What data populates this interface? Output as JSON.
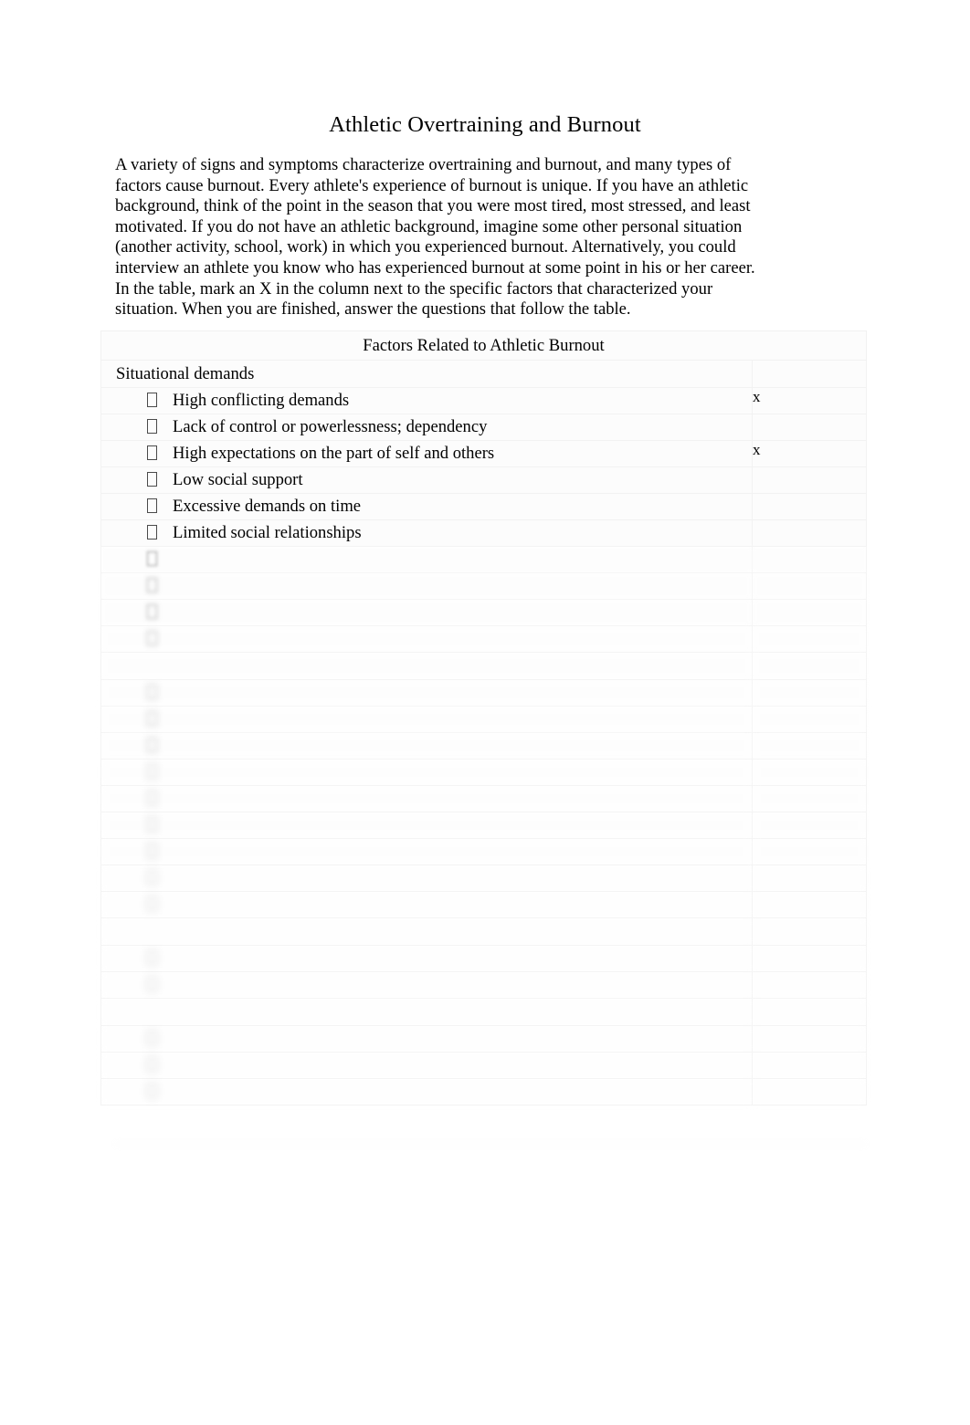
{
  "document": {
    "title": "Athletic Overtraining and Burnout",
    "intro_paragraphs": [
      "A variety of signs and symptoms characterize overtraining and burnout, and many types of factors cause burnout. Every athlete's experience of burnout is unique. If you have an athletic background, think of the point in the season that you were most tired, most stressed, and least motivated. If you do not have an athletic background, imagine some other personal situation (another activity, school, work) in which you experienced burnout. Alternatively, you could interview an athlete you know who has experienced burnout at some point in his or her career.",
      "In the table, mark an X in the column next to the specific factors that characterized your situation. When you are finished, answer the questions that follow the table."
    ]
  },
  "table": {
    "caption": "Factors Related to Athletic Burnout",
    "mark_symbol": "x",
    "bullet_glyph": "missing-glyph-box",
    "rows": [
      {
        "kind": "section",
        "label": "Situational demands",
        "mark": "",
        "legibility": "clear"
      },
      {
        "kind": "item",
        "label": "High conflicting demands",
        "mark": "x",
        "legibility": "clear"
      },
      {
        "kind": "item",
        "label": "Lack of control or powerlessness; dependency",
        "mark": "",
        "legibility": "clear"
      },
      {
        "kind": "item",
        "label": "High expectations on the part of self and others",
        "mark": "x",
        "legibility": "clear"
      },
      {
        "kind": "item",
        "label": "Low social support",
        "mark": "",
        "legibility": "clear"
      },
      {
        "kind": "item",
        "label": "Excessive demands on time",
        "mark": "",
        "legibility": "clear"
      },
      {
        "kind": "item",
        "label": "Limited social relationships",
        "mark": "",
        "legibility": "clear"
      },
      {
        "kind": "item",
        "label": "",
        "mark": "",
        "legibility": "blurred",
        "blur": "b1"
      },
      {
        "kind": "item",
        "label": "",
        "mark": "",
        "legibility": "blurred",
        "blur": "b2"
      },
      {
        "kind": "item",
        "label": "",
        "mark": "",
        "legibility": "blurred",
        "blur": "b2"
      },
      {
        "kind": "item",
        "label": "",
        "mark": "",
        "legibility": "blurred",
        "blur": "b3"
      },
      {
        "kind": "section",
        "label": "",
        "mark": "",
        "legibility": "blurred",
        "blur": "b3"
      },
      {
        "kind": "item",
        "label": "",
        "mark": "",
        "legibility": "blurred",
        "blur": "b4"
      },
      {
        "kind": "item",
        "label": "",
        "mark": "",
        "legibility": "blurred",
        "blur": "b4"
      },
      {
        "kind": "item",
        "label": "",
        "mark": "",
        "legibility": "blurred",
        "blur": "b4"
      },
      {
        "kind": "item",
        "label": "",
        "mark": "",
        "legibility": "blurred",
        "blur": "b5"
      },
      {
        "kind": "item",
        "label": "",
        "mark": "",
        "legibility": "blurred",
        "blur": "b5"
      },
      {
        "kind": "item",
        "label": "",
        "mark": "",
        "legibility": "blurred",
        "blur": "b5"
      },
      {
        "kind": "item",
        "label": "",
        "mark": "",
        "legibility": "blurred",
        "blur": "b5"
      },
      {
        "kind": "item",
        "label": "",
        "mark": "",
        "legibility": "blurred",
        "blur": "b6"
      },
      {
        "kind": "item",
        "label": "",
        "mark": "",
        "legibility": "blurred",
        "blur": "b6"
      },
      {
        "kind": "section",
        "label": "",
        "mark": "",
        "legibility": "blurred",
        "blur": "b6"
      },
      {
        "kind": "item",
        "label": "",
        "mark": "",
        "legibility": "blurred",
        "blur": "b6"
      },
      {
        "kind": "item",
        "label": "",
        "mark": "",
        "legibility": "blurred",
        "blur": "b6"
      },
      {
        "kind": "section",
        "label": "",
        "mark": "",
        "legibility": "blurred",
        "blur": "b6"
      },
      {
        "kind": "item",
        "label": "",
        "mark": "",
        "legibility": "blurred",
        "blur": "b6"
      },
      {
        "kind": "item",
        "label": "",
        "mark": "",
        "legibility": "blurred",
        "blur": "b6"
      },
      {
        "kind": "item",
        "label": "",
        "mark": "",
        "legibility": "blurred",
        "blur": "b6"
      }
    ]
  },
  "footer": {
    "line1": "",
    "line2": "",
    "page_number": ""
  }
}
